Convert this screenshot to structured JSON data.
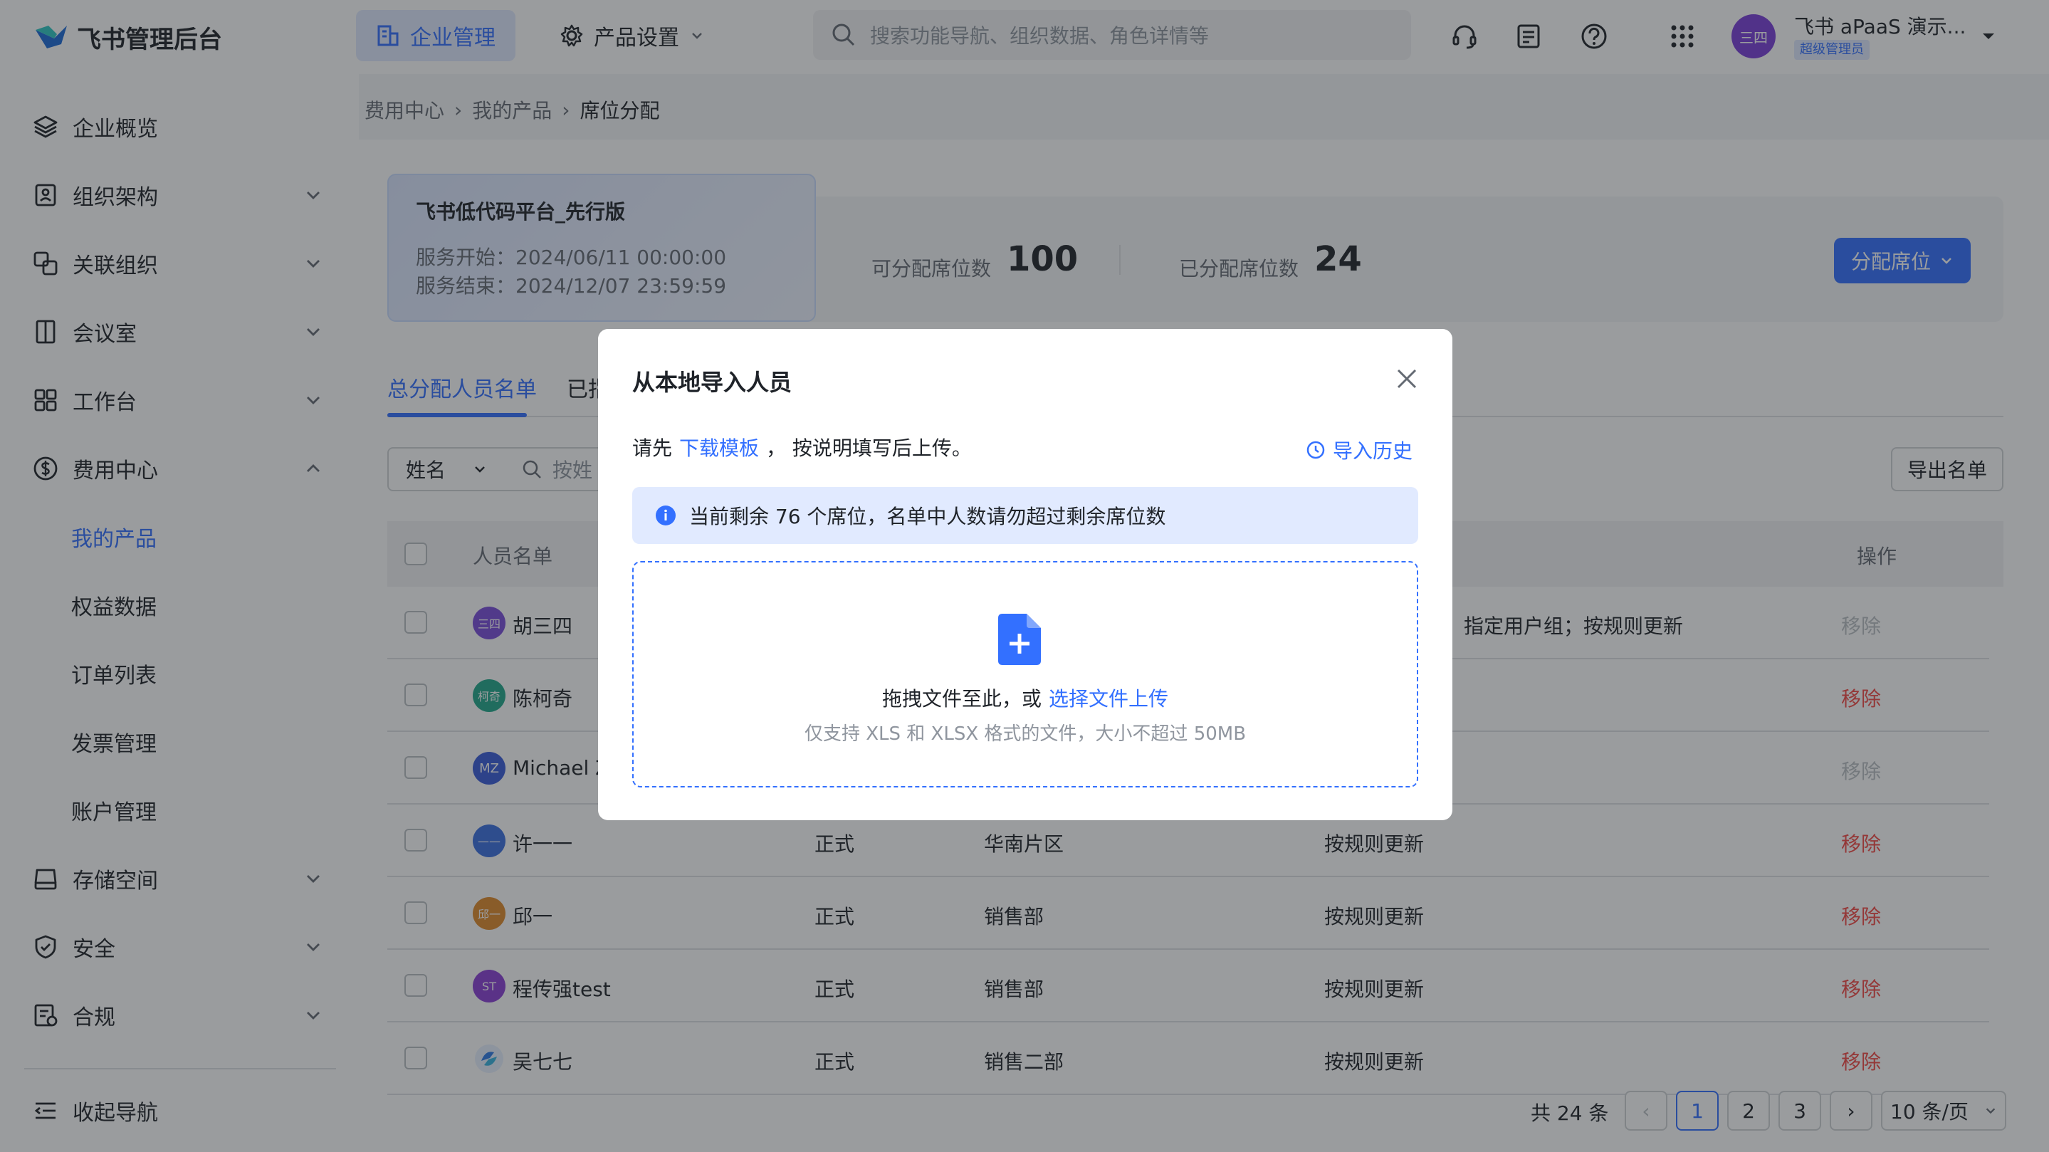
{
  "header": {
    "app_name": "飞书管理后台",
    "nav": [
      {
        "label": "企业管理",
        "icon": "building-icon"
      },
      {
        "label": "产品设置",
        "icon": "gear-icon"
      }
    ],
    "search_placeholder": "搜索功能导航、组织数据、角色详情等",
    "user": {
      "avatar_text": "三四",
      "name": "飞书 aPaaS 演示...",
      "role_badge": "超级管理员"
    }
  },
  "sidebar": {
    "items": [
      {
        "label": "企业概览",
        "icon": "layers-icon"
      },
      {
        "label": "组织架构",
        "icon": "org-icon"
      },
      {
        "label": "关联组织",
        "icon": "link-org-icon"
      },
      {
        "label": "会议室",
        "icon": "door-icon"
      },
      {
        "label": "工作台",
        "icon": "grid-icon"
      },
      {
        "label": "费用中心",
        "icon": "dollar-icon"
      }
    ],
    "sub_items": [
      "我的产品",
      "权益数据",
      "订单列表",
      "发票管理",
      "账户管理"
    ],
    "items_after": [
      {
        "label": "存储空间",
        "icon": "storage-icon"
      },
      {
        "label": "安全",
        "icon": "shield-icon"
      },
      {
        "label": "合规",
        "icon": "compliance-icon"
      }
    ],
    "collapse_label": "收起导航"
  },
  "breadcrumb": [
    "费用中心",
    "我的产品",
    "席位分配"
  ],
  "product": {
    "name": "飞书低代码平台_先行版",
    "start": "服务开始：2024/06/11 00:00:00",
    "end": "服务结束：2024/12/07 23:59:59"
  },
  "stats": {
    "available_label": "可分配席位数",
    "available_value": "100",
    "assigned_label": "已分配席位数",
    "assigned_value": "24",
    "assign_button": "分配席位"
  },
  "tabs": [
    "总分配人员名单",
    "已指"
  ],
  "filters": {
    "field_select": "姓名",
    "search_placeholder": "按姓",
    "export_button": "导出名单"
  },
  "table": {
    "headers": {
      "name": "人员名单",
      "action": "操作"
    },
    "rows": [
      {
        "avatar": "三四",
        "avatar_color": "#7a4ddb",
        "name": "胡三四",
        "type": "",
        "dept": "",
        "rule": "指定用户组；按规则更新",
        "action": "移除",
        "disabled": true
      },
      {
        "avatar": "柯奇",
        "avatar_color": "#22a88a",
        "name": "陈柯奇",
        "type": "",
        "dept": "",
        "rule": "",
        "action": "移除",
        "disabled": false
      },
      {
        "avatar": "MZ",
        "avatar_color": "#3a5bd9",
        "name": "Michael Z",
        "type": "",
        "dept": "",
        "rule": "",
        "action": "移除",
        "disabled": true
      },
      {
        "avatar": "——",
        "avatar_color": "#3b6fe0",
        "name": "许一一",
        "type": "正式",
        "dept": "华南片区",
        "rule": "按规则更新",
        "action": "移除",
        "disabled": false
      },
      {
        "avatar": "邱一",
        "avatar_color": "#e08a2b",
        "name": "邱一",
        "type": "正式",
        "dept": "销售部",
        "rule": "按规则更新",
        "action": "移除",
        "disabled": false
      },
      {
        "avatar": "ST",
        "avatar_color": "#8a3fd6",
        "name": "程传强test",
        "type": "正式",
        "dept": "销售部",
        "rule": "按规则更新",
        "action": "移除",
        "disabled": false
      },
      {
        "avatar": "",
        "avatar_color": "#2e7be6",
        "name": "吴七七",
        "type": "正式",
        "dept": "销售二部",
        "rule": "按规则更新",
        "action": "移除",
        "disabled": false
      }
    ]
  },
  "pagination": {
    "total": "共 24 条",
    "pages": [
      "1",
      "2",
      "3"
    ],
    "page_size": "10 条/页"
  },
  "modal": {
    "title": "从本地导入人员",
    "instruction_prefix": "请先",
    "download_link": "下载模板",
    "instruction_suffix": "，  按说明填写后上传。",
    "history_link": "导入历史",
    "info": "当前剩余 76 个席位，名单中人数请勿超过剩余席位数",
    "drop_text": "拖拽文件至此，或",
    "select_link": "选择文件上传",
    "hint": "仅支持 XLS 和 XLSX 格式的文件，大小不超过 50MB"
  }
}
